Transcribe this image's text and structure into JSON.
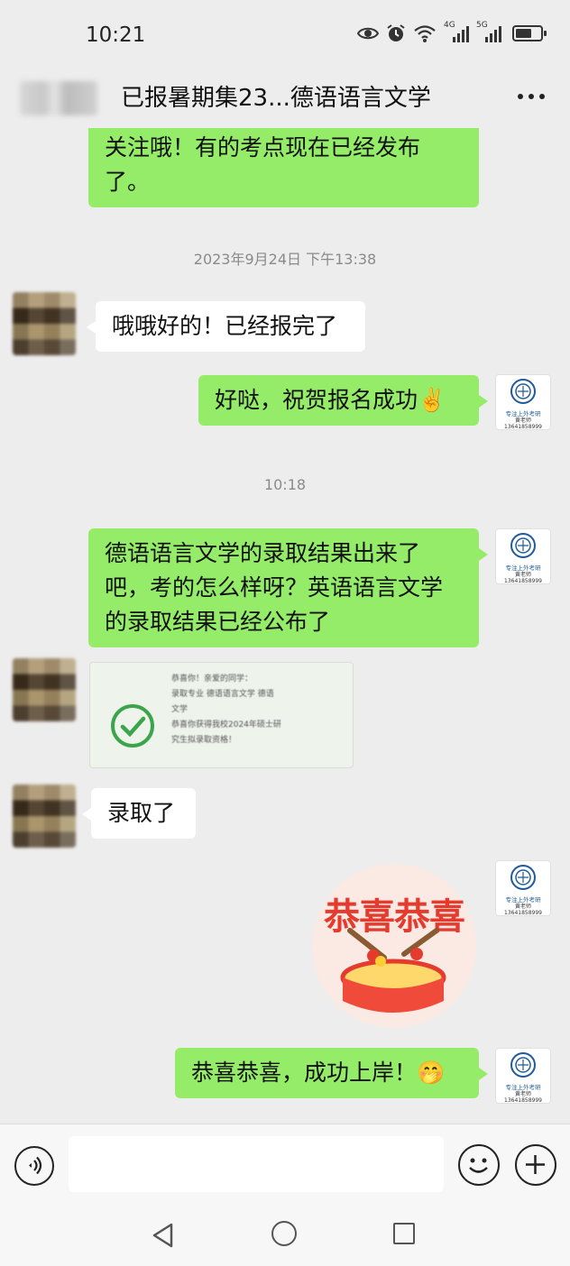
{
  "status_bar": {
    "time": "10:21",
    "signal_1_label": "4G",
    "signal_2_label": "5G",
    "icons": [
      "eye-icon",
      "alarm-icon",
      "wifi-icon",
      "signal-icon",
      "battery-icon"
    ]
  },
  "header": {
    "title": "已报暑期集23...德语语言文学",
    "more_icon": "more-icon"
  },
  "messages": [
    {
      "side": "right",
      "type": "text",
      "text": "关注哦！有的考点现在已经发布了。"
    },
    {
      "type": "timestamp",
      "text": "2023年9月24日 下午13:38"
    },
    {
      "side": "left",
      "type": "text",
      "text": "哦哦好的！已经报完了"
    },
    {
      "side": "right",
      "type": "text",
      "text": "好哒，祝贺报名成功✌️"
    },
    {
      "type": "timestamp",
      "text": "10:18"
    },
    {
      "side": "right",
      "type": "text",
      "text": "德语语言文学的录取结果出来了吧，考的怎么样呀？英语语言文学的录取结果已经公布了"
    },
    {
      "side": "left",
      "type": "image",
      "image_text": "恭喜你！亲爱的同学：\n录取专业 德语语言文学 德语\n文学\n恭喜你获得我校2024年硕士研\n究生拟录取资格！"
    },
    {
      "side": "left",
      "type": "text",
      "text": "录取了"
    },
    {
      "side": "right",
      "type": "sticker",
      "sticker_text": "恭喜恭喜"
    },
    {
      "side": "right",
      "type": "text",
      "text": "恭喜恭喜，成功上岸！🤭"
    }
  ],
  "teacher_avatar": {
    "line1": "专注上外考研",
    "line2": "黄老师",
    "line3": "13641858999"
  },
  "input_bar": {
    "value": "",
    "icons": [
      "voice-icon",
      "emoji-icon",
      "plus-icon"
    ]
  },
  "nav_bar": {
    "icons": [
      "back-icon",
      "home-icon",
      "recent-apps-icon"
    ]
  },
  "colors": {
    "background": "#ededed",
    "green_bubble": "#95ec69",
    "white_bubble": "#ffffff",
    "timestamp": "#8a8a8a"
  }
}
